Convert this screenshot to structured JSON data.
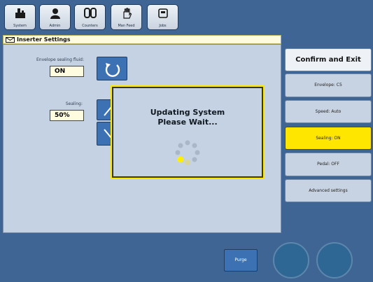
{
  "toolbar": {
    "buttons": [
      {
        "label": "System",
        "icon": "system-icon"
      },
      {
        "label": "Admin",
        "icon": "admin-icon"
      },
      {
        "label": "Counters",
        "icon": "counters-icon"
      },
      {
        "label": "Man Feed",
        "icon": "hand-icon"
      },
      {
        "label": "Jobs",
        "icon": "jobs-icon"
      }
    ]
  },
  "header": {
    "title": "Inserter Settings",
    "icon": "envelope-icon"
  },
  "settings": {
    "envelope_sealing_fluid": {
      "label": "Envelope sealing fluid:",
      "value": "ON"
    },
    "sealing": {
      "label": "Sealing:",
      "value": "50%"
    }
  },
  "modal": {
    "line1": "Updating System",
    "line2": "Please Wait..."
  },
  "sidebar": {
    "items": [
      {
        "label": "Confirm and Exit",
        "state": "primary"
      },
      {
        "label": "Envelope: C5",
        "state": "normal"
      },
      {
        "label": "Speed: Auto",
        "state": "normal"
      },
      {
        "label": "Sealing: ON",
        "state": "active"
      },
      {
        "label": "Pedal: OFF",
        "state": "normal"
      },
      {
        "label": "Advanced settings",
        "state": "normal"
      }
    ]
  },
  "bottom": {
    "purge_label": "Purge"
  },
  "colors": {
    "background": "#3f6594",
    "panel": "#c5d2e3",
    "highlight": "#ffe800",
    "button_blue": "#3c72b4"
  }
}
